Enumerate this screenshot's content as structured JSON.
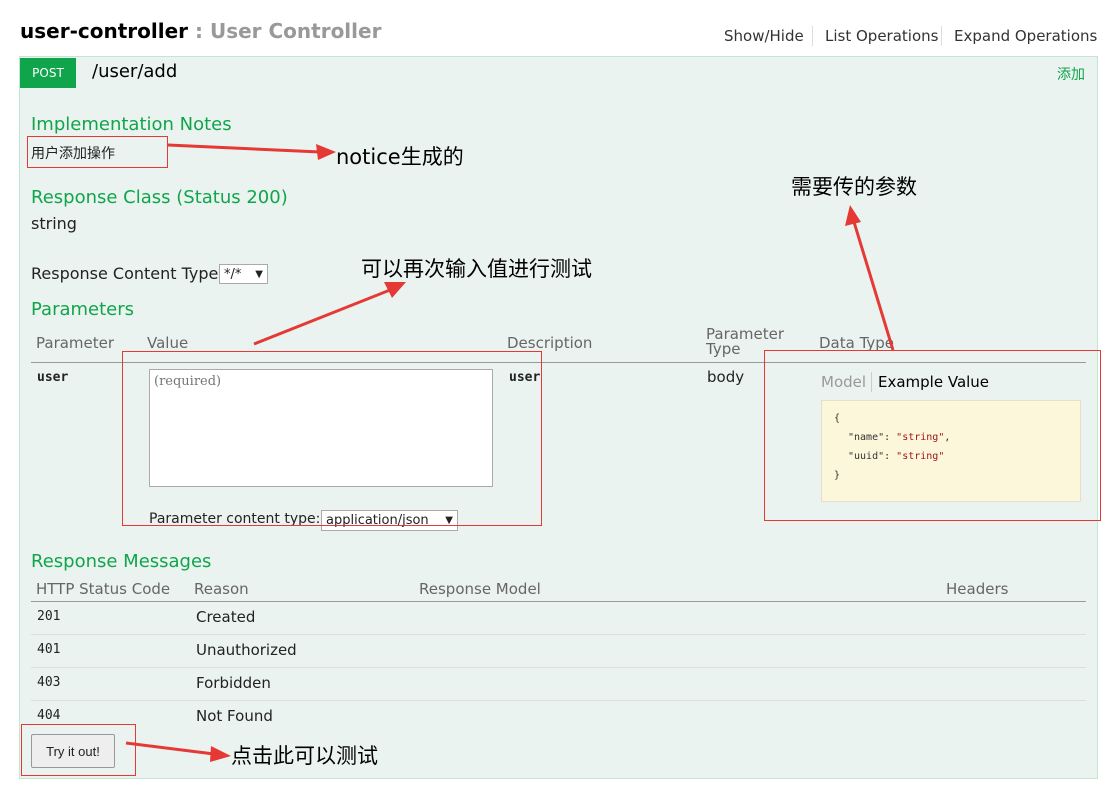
{
  "header": {
    "controller_name": "user-controller",
    "separator": " : ",
    "controller_description": "User Controller",
    "links": [
      "Show/Hide",
      "List Operations",
      "Expand Operations"
    ]
  },
  "operation": {
    "method": "POST",
    "path": "/user/add",
    "summary": "添加",
    "implementation_notes_title": "Implementation Notes",
    "implementation_notes": "用户添加操作",
    "response_class_title": "Response Class (Status 200)",
    "response_class": "string",
    "response_content_type_label": "Response Content Type",
    "response_content_type_value": "*/*"
  },
  "parameters": {
    "title": "Parameters",
    "headers": {
      "parameter": "Parameter",
      "value": "Value",
      "description": "Description",
      "parameter_type_line1": "Parameter",
      "parameter_type_line2": "Type",
      "data_type": "Data Type"
    },
    "row": {
      "name": "user",
      "placeholder": "(required)",
      "description": "user",
      "type": "body",
      "content_type_label": "Parameter content type:",
      "content_type_value": "application/json"
    },
    "data_type_tabs": {
      "model": "Model",
      "example": "Example Value"
    },
    "example_lines": {
      "open": "{",
      "name_key": "\"name\": ",
      "name_val": "\"string\"",
      "comma": ",",
      "uuid_key": "\"uuid\": ",
      "uuid_val": "\"string\"",
      "close": "}"
    }
  },
  "response_messages": {
    "title": "Response Messages",
    "headers": [
      "HTTP Status Code",
      "Reason",
      "Response Model",
      "Headers"
    ],
    "rows": [
      {
        "code": "201",
        "reason": "Created"
      },
      {
        "code": "401",
        "reason": "Unauthorized"
      },
      {
        "code": "403",
        "reason": "Forbidden"
      },
      {
        "code": "404",
        "reason": "Not Found"
      }
    ]
  },
  "try_button": "Try it out!",
  "annotations": {
    "notice": "notice生成的",
    "retest": "可以再次输入值进行测试",
    "params_needed": "需要传的参数",
    "click_test": "点击此可以测试"
  },
  "colors": {
    "accent_green": "#10a54a",
    "panel_bg": "#ebf3f0",
    "panel_border": "#c3e8d1",
    "example_bg": "#fcf6db",
    "annotation_red": "#e53935"
  }
}
